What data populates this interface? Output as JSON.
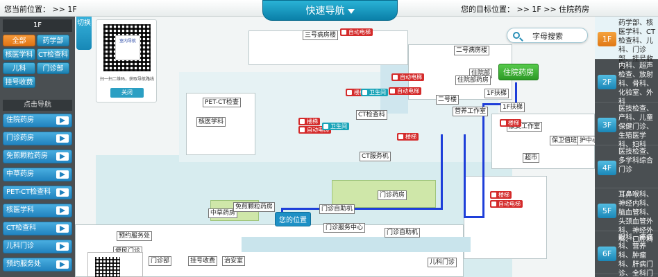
{
  "top": {
    "current_location": "您当前位置： >> 1F",
    "quick_nav": "快速导航",
    "target_location": "您的目标位置： >> 1F >> 住院药房"
  },
  "left": {
    "floor_header": "1F",
    "depts": [
      "全部",
      "药学部",
      "核医学科",
      "CT检查科",
      "儿科",
      "门诊部",
      "挂号收费"
    ],
    "click_nav_header": "点击导航",
    "nav_items": [
      "住院药房",
      "门诊药房",
      "免煎颗粒药房",
      "中草药房",
      "PET-CT检查科",
      "核医学科",
      "CT检查科",
      "儿科门诊",
      "预约服务处"
    ],
    "switch_label": "切换"
  },
  "qr": {
    "logo_text": "室内导航",
    "caption": "扫一扫二维码，获取导航路线",
    "close": "关闭"
  },
  "search": {
    "label": "字母搜索"
  },
  "map": {
    "you_are_here": "您的位置",
    "destination": "住院药房",
    "labels": [
      "三号病房楼",
      "二号病房楼",
      "住院部",
      "住院部药房",
      "1F扶梯",
      "二号楼",
      "营养工作室",
      "1F扶梯",
      "康复工作室",
      "保卫值班室",
      "超市",
      "PET-CT检查",
      "核医学科",
      "CT检查科",
      "CT服务机",
      "门诊药房",
      "中草药房",
      "免煎颗粒药房",
      "门诊自助机",
      "门诊自助机",
      "门诊服务中心",
      "预约服务处",
      "便民门诊",
      "门诊部",
      "挂号收费",
      "治安室",
      "儿科门诊",
      "护中心"
    ],
    "red_tags": [
      "自动电梯",
      "楼梯",
      "自动电梯",
      "楼梯",
      "自动电梯",
      "楼梯",
      "自动电梯",
      "楼梯",
      "自动电梯",
      "楼梯"
    ],
    "teal_tags": [
      "卫生间",
      "卫生间"
    ]
  },
  "floors": [
    {
      "badge": "1F",
      "text": "药学部、核医学科、CT检查科、儿科、门诊部、挂号收费"
    },
    {
      "badge": "2F",
      "text": "内科、超声检查、放射科、骨科、化验室、外科"
    },
    {
      "badge": "3F",
      "text": "医技检查、产科、儿童保健门诊、生殖医学科、妇科"
    },
    {
      "badge": "4F",
      "text": "医技检查、多学科综合门诊"
    },
    {
      "badge": "5F",
      "text": "耳鼻喉科、神经内科、脑血管科、头颈血管外科、神经外科、口腔科"
    },
    {
      "badge": "6F",
      "text": "眼科、疼痛科、营养科、肿瘤科、肝病门诊、全科门诊、中医科"
    }
  ]
}
